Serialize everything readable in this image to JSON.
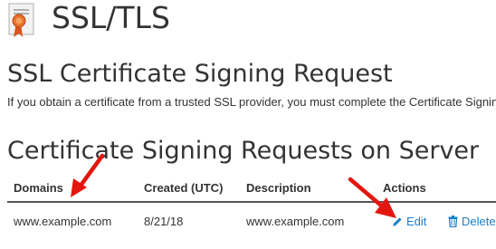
{
  "header": {
    "title": "SSL/TLS",
    "icon": "certificate-icon"
  },
  "csr_section": {
    "heading": "SSL Certificate Signing Request",
    "intro": "If you obtain a certificate from a trusted SSL provider, you must complete the Certificate Signing R"
  },
  "table_section": {
    "heading": "Certificate Signing Requests on Server",
    "columns": [
      "Domains",
      "Created (UTC)",
      "Description",
      "Actions"
    ],
    "rows": [
      {
        "domain": "www.example.com",
        "created": "8/21/18",
        "description": "www.example.com",
        "actions": [
          "Edit",
          "Delete"
        ]
      }
    ]
  },
  "colors": {
    "text": "#333333",
    "link": "#1b7ec6",
    "annotation_arrow": "#e3170f",
    "icon_ribbon": "#d9541e"
  },
  "icons": [
    "certificate-icon",
    "pencil-icon",
    "trash-icon",
    "arrow-annotation"
  ]
}
